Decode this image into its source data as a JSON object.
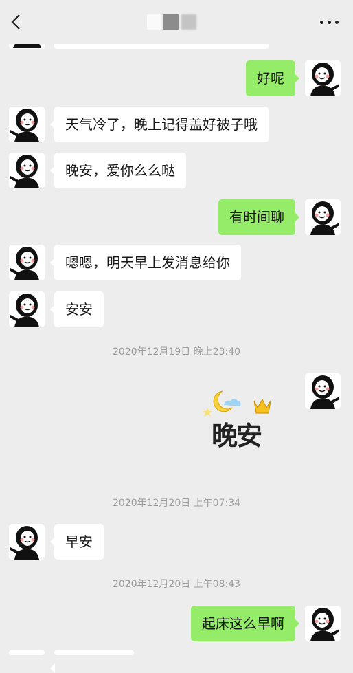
{
  "header": {
    "back_icon": "chevron-left-icon",
    "more_icon": "more-dots-icon"
  },
  "messages": [
    {
      "id": "m1",
      "side": "right",
      "text": "好呢"
    },
    {
      "id": "m2",
      "side": "left",
      "text": "天气冷了，晚上记得盖好被子哦"
    },
    {
      "id": "m3",
      "side": "left",
      "text": "晚安，爱你么么哒"
    },
    {
      "id": "m4",
      "side": "right",
      "text": "有时间聊"
    },
    {
      "id": "m5",
      "side": "left",
      "text": "嗯嗯，明天早上发消息给你"
    },
    {
      "id": "m6",
      "side": "left",
      "text": "安安"
    },
    {
      "id": "t1",
      "type": "timestamp",
      "text": "2020年12月19日 晚上23:40"
    },
    {
      "id": "s1",
      "side": "right",
      "type": "sticker",
      "text": "晚安"
    },
    {
      "id": "t2",
      "type": "timestamp",
      "text": "2020年12月20日 上午07:34"
    },
    {
      "id": "m7",
      "side": "left",
      "text": "早安"
    },
    {
      "id": "t3",
      "type": "timestamp",
      "text": "2020年12月20日 上午08:43"
    },
    {
      "id": "m8",
      "side": "right",
      "text": "起床这么早啊"
    }
  ],
  "colors": {
    "background": "#ededed",
    "bubble_self": "#95ec69",
    "bubble_other": "#ffffff",
    "timestamp_text": "#9b9b9b"
  }
}
